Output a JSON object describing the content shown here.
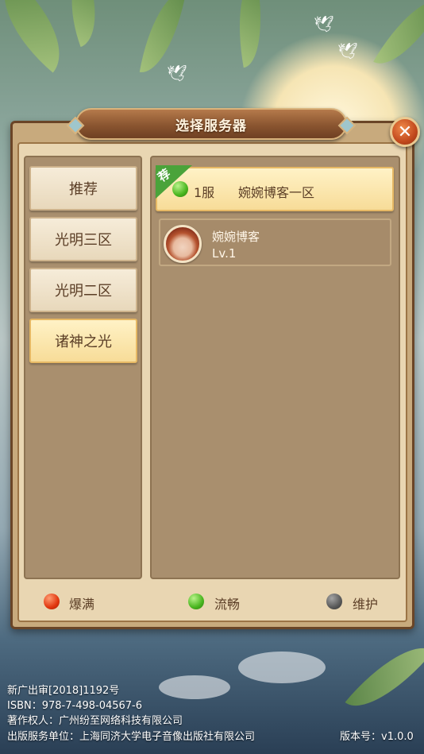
{
  "dialog": {
    "title": "选择服务器",
    "close_icon": "close-icon"
  },
  "tabs": [
    {
      "label": "推荐",
      "active": false
    },
    {
      "label": "光明三区",
      "active": false
    },
    {
      "label": "光明二区",
      "active": false
    },
    {
      "label": "诸神之光",
      "active": true
    }
  ],
  "servers": [
    {
      "badge": "荐",
      "status": "green",
      "id": "1服",
      "name": "婉婉博客一区"
    }
  ],
  "character": {
    "name": "婉婉博客",
    "level": "Lv.1"
  },
  "legend": [
    {
      "label": "爆满",
      "color": "#e1360e"
    },
    {
      "label": "流畅",
      "color": "#48b51e"
    },
    {
      "label": "维护",
      "color": "#595959"
    }
  ],
  "footer": {
    "approval": "新广出审[2018]1192号",
    "isbn": "ISBN：978-7-498-04567-6",
    "copyright": "著作权人：广州纷至网络科技有限公司",
    "publisher": "出版服务单位：上海同济大学电子音像出版社有限公司",
    "version": "版本号：v1.0.0"
  }
}
